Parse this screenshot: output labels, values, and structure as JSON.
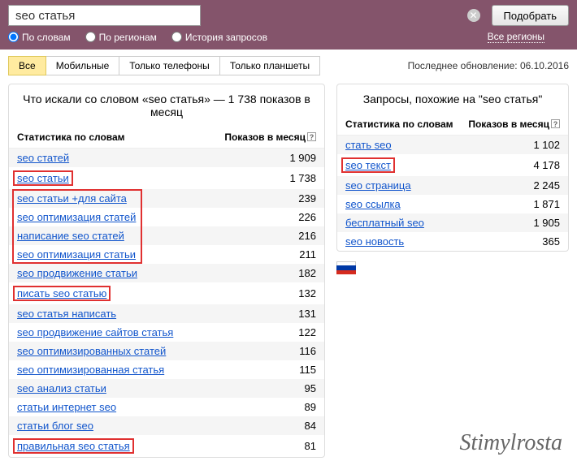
{
  "search": {
    "value": "seo статья",
    "submit": "Подобрать"
  },
  "radios": {
    "by_words": "По словам",
    "by_regions": "По регионам",
    "history": "История запросов"
  },
  "regions_link": "Все регионы",
  "tabs": {
    "all": "Все",
    "mobile": "Мобильные",
    "phones": "Только телефоны",
    "tablets": "Только планшеты"
  },
  "update_info": "Последнее обновление: 06.10.2016",
  "left": {
    "title": "Что искали со словом «seo статья» — 1 738 показов в месяц",
    "header_left": "Статистика по словам",
    "header_right": "Показов в месяц",
    "rows": [
      {
        "label": "seo статей",
        "count": "1 909",
        "hl": false
      },
      {
        "label": "seo статьи",
        "count": "1 738",
        "hl": true
      },
      {
        "label": "seo статьи +для сайта",
        "count": "239",
        "hl": false
      },
      {
        "label": "seo оптимизация статей",
        "count": "226",
        "hl": false
      },
      {
        "label": "написание seo статей",
        "count": "216",
        "hl": false
      },
      {
        "label": "seo оптимизация статьи",
        "count": "211",
        "hl": false
      },
      {
        "label": "seo продвижение статьи",
        "count": "182",
        "hl": false
      },
      {
        "label": "писать seo статью",
        "count": "132",
        "hl": true
      },
      {
        "label": "seo статья написать",
        "count": "131",
        "hl": false
      },
      {
        "label": "seo продвижение сайтов статья",
        "count": "122",
        "hl": false
      },
      {
        "label": "seo оптимизированных статей",
        "count": "116",
        "hl": false
      },
      {
        "label": "seo оптимизированная статья",
        "count": "115",
        "hl": false
      },
      {
        "label": "seo анализ статьи",
        "count": "95",
        "hl": false
      },
      {
        "label": "статьи интернет seo",
        "count": "89",
        "hl": false
      },
      {
        "label": "статьи блог seo",
        "count": "84",
        "hl": false
      },
      {
        "label": "правильная seo статья",
        "count": "81",
        "hl": true
      }
    ]
  },
  "right": {
    "title": "Запросы, похожие на \"seo статья\"",
    "header_left": "Статистика по словам",
    "header_right": "Показов в месяц",
    "rows": [
      {
        "label": "стать seo",
        "count": "1 102",
        "hl": false
      },
      {
        "label": "seo текст",
        "count": "4 178",
        "hl": true
      },
      {
        "label": "seo страница",
        "count": "2 245",
        "hl": false
      },
      {
        "label": "seo ссылка",
        "count": "1 871",
        "hl": false
      },
      {
        "label": "бесплатный seo",
        "count": "1 905",
        "hl": false
      },
      {
        "label": "seo новость",
        "count": "365",
        "hl": false
      }
    ]
  },
  "watermark": "Stimylrosta",
  "left_box_hl": true
}
